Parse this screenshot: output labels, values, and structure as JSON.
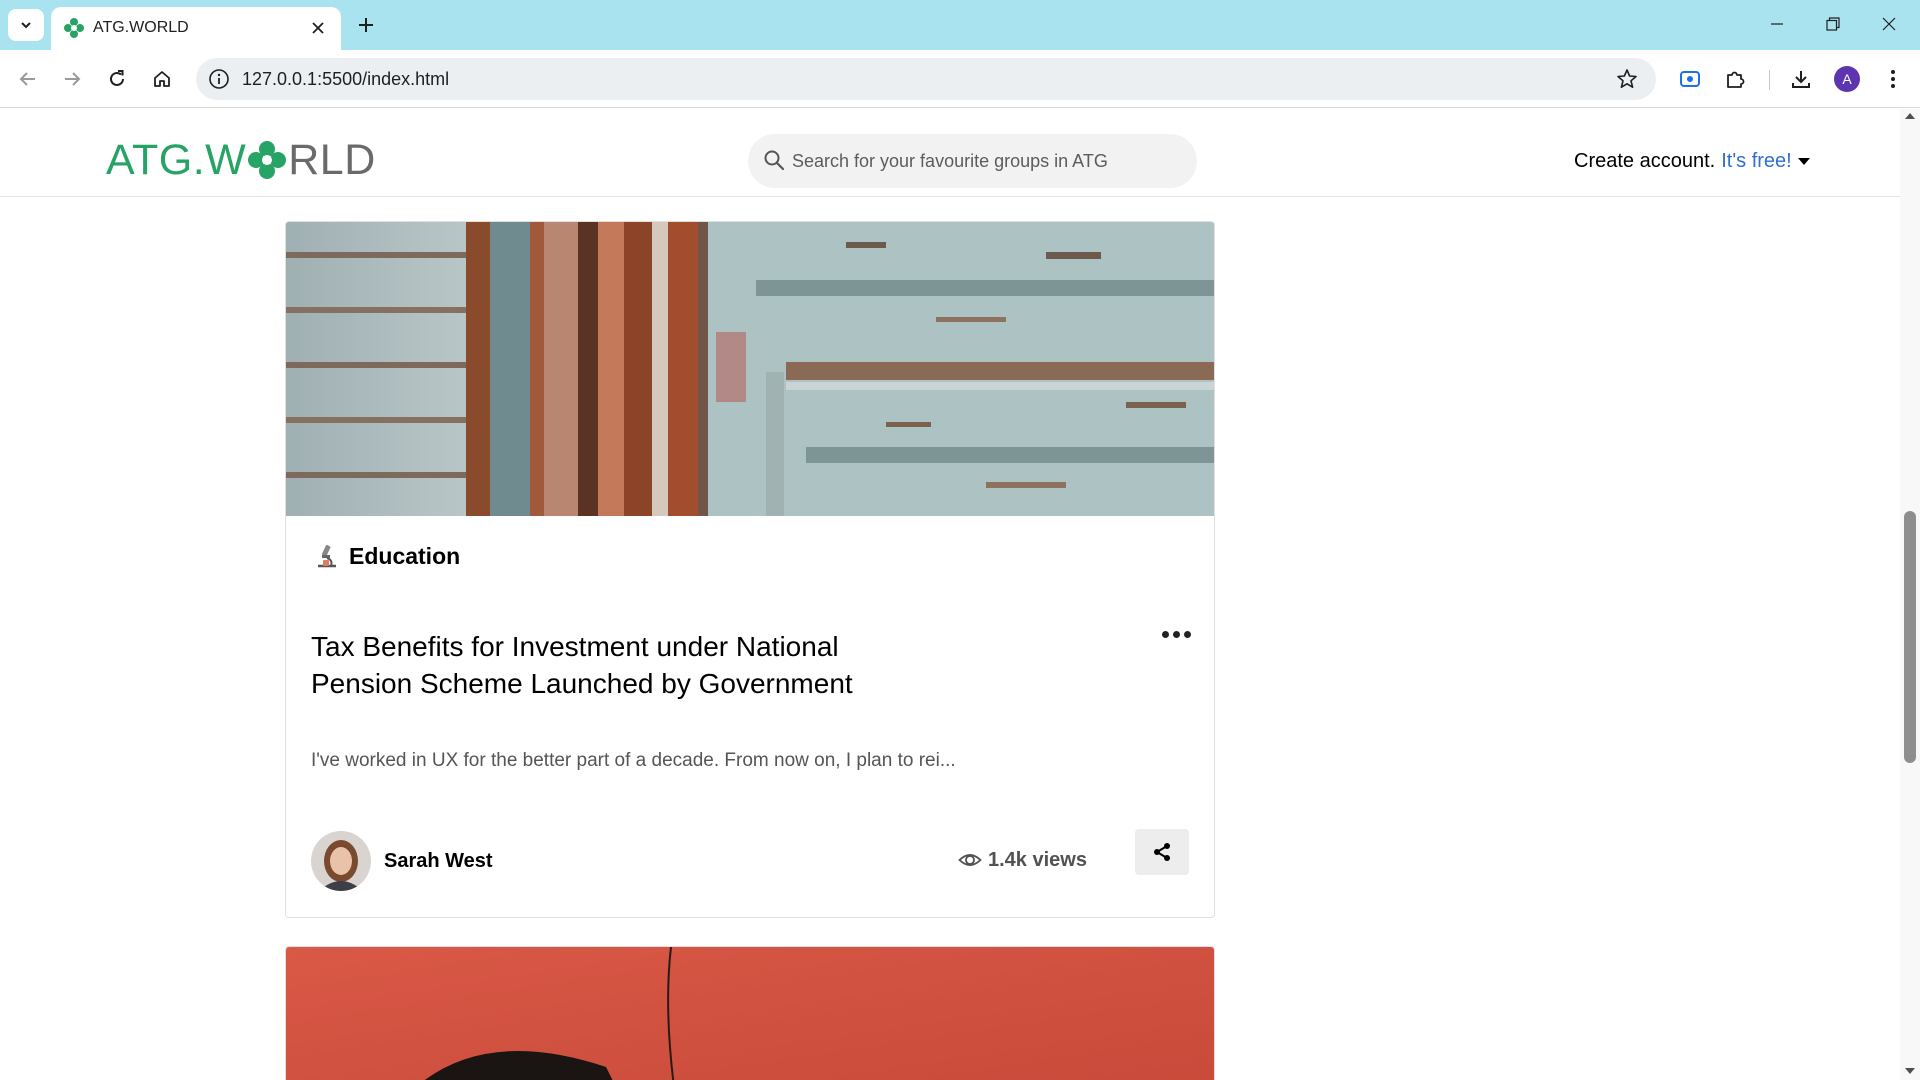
{
  "browser": {
    "tab_title": "ATG.WORLD",
    "url": "127.0.0.1:5500/index.html",
    "profile_initial": "A"
  },
  "site": {
    "logo": {
      "part1": "ATG.W",
      "part2": "RLD",
      "brand_color": "#27a365"
    },
    "search": {
      "placeholder": "Search for your favourite groups in ATG"
    },
    "create_account": {
      "text": "Create account.",
      "free_text": "It's free!",
      "link_color": "#2f6fd1"
    }
  },
  "posts": [
    {
      "category": "Education",
      "category_icon": "microscope-icon",
      "title": "Tax Benefits for Investment under National Pension Scheme Launched by Government",
      "excerpt": "I've worked in UX for the better part of a decade. From now on, I plan to rei...",
      "author": "Sarah West",
      "views": "1.4k views"
    }
  ]
}
